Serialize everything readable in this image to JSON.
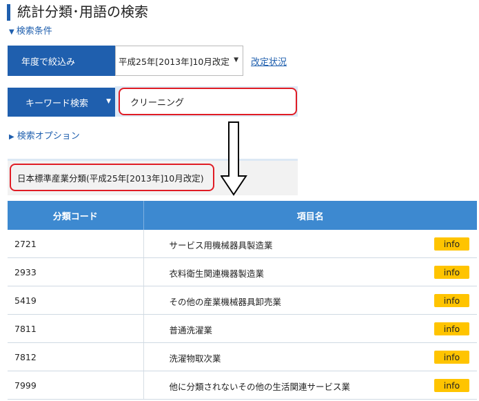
{
  "page": {
    "title": "統計分類･用語の検索"
  },
  "search": {
    "conditions_toggle": "検索条件",
    "filter_label": "年度で絞込み",
    "filter_selected": "平成25年[2013年]10月改定",
    "revision_link": "改定状況",
    "keyword_label": "キーワード検索",
    "keyword_value": "クリーニング",
    "options_toggle": "検索オプション"
  },
  "results": {
    "classification_title": "日本標準産業分類(平成25年[2013年]10月改定)",
    "columns": [
      "分類コード",
      "項目名"
    ],
    "info_label": "info",
    "rows": [
      {
        "code": "2721",
        "name": "サービス用機械器具製造業"
      },
      {
        "code": "2933",
        "name": "衣料衛生関連機器製造業"
      },
      {
        "code": "5419",
        "name": "その他の産業機械器具卸売業"
      },
      {
        "code": "7811",
        "name": "普通洗濯業"
      },
      {
        "code": "7812",
        "name": "洗濯物取次業"
      },
      {
        "code": "7999",
        "name": "他に分類されないその他の生活関連サービス業"
      }
    ]
  },
  "colors": {
    "primary": "#1f5fae",
    "table_header": "#3d89d0",
    "info_button": "#ffc400",
    "highlight": "#e01b24"
  },
  "icons": [
    "triangle-down-icon",
    "triangle-right-icon",
    "dropdown-arrow-icon",
    "down-arrow-annotation"
  ]
}
